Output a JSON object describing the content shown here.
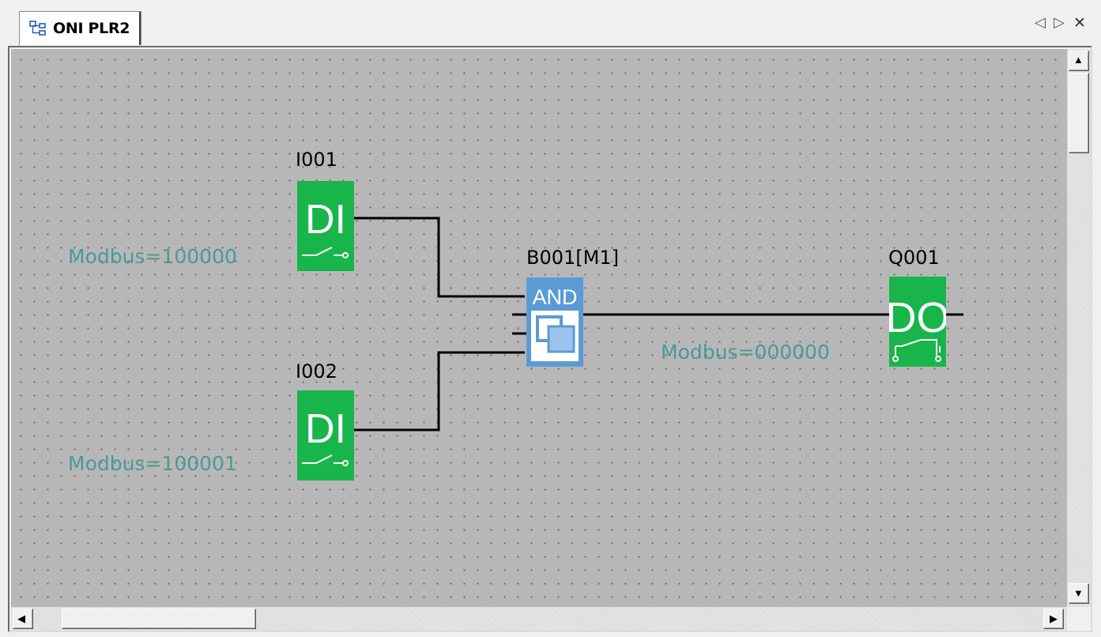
{
  "tab": {
    "title": "ONI PLR2",
    "icon": "network-diagram-icon"
  },
  "nav": {
    "prev": "◁",
    "next": "▷",
    "close": "✕"
  },
  "blocks": {
    "i001": {
      "label": "I001",
      "glyph": "DI",
      "modbus": "Modbus=100000"
    },
    "i002": {
      "label": "I002",
      "glyph": "DI",
      "modbus": "Modbus=100001"
    },
    "b001": {
      "label": "B001[M1]",
      "glyph": "AND"
    },
    "q001": {
      "label": "Q001",
      "glyph": "DO",
      "modbus": "Modbus=000000"
    }
  },
  "colors": {
    "io_block": "#18b54a",
    "logic_block": "#5b9bd5",
    "modbus_text": "#4a9a94",
    "canvas": "#b7b7b7"
  },
  "scrollbars": {
    "up": "▲",
    "down": "▼",
    "left": "◀",
    "right": "▶"
  }
}
